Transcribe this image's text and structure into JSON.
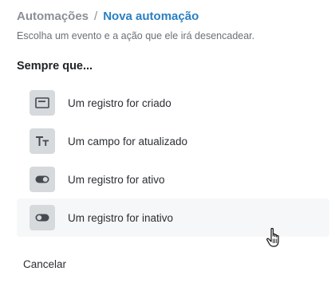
{
  "breadcrumb": {
    "parent": "Automações",
    "separator": "/",
    "current": "Nova automação"
  },
  "subtitle": "Escolha um evento e a ação que ele irá desencadear.",
  "section_title": "Sempre que...",
  "events": [
    {
      "label": "Um registro for criado",
      "icon": "record-icon"
    },
    {
      "label": "Um campo for atualizado",
      "icon": "text-field-icon"
    },
    {
      "label": "Um registro for ativo",
      "icon": "toggle-on-icon"
    },
    {
      "label": "Um registro for inativo",
      "icon": "toggle-off-icon",
      "hovered": true
    }
  ],
  "cancel_label": "Cancelar",
  "colors": {
    "accent": "#2a7fc1",
    "muted": "#8b8f96",
    "icon_bg": "#d7dadd",
    "hover_bg": "#f6f7f8"
  },
  "cursor": "hand-pointer-icon"
}
